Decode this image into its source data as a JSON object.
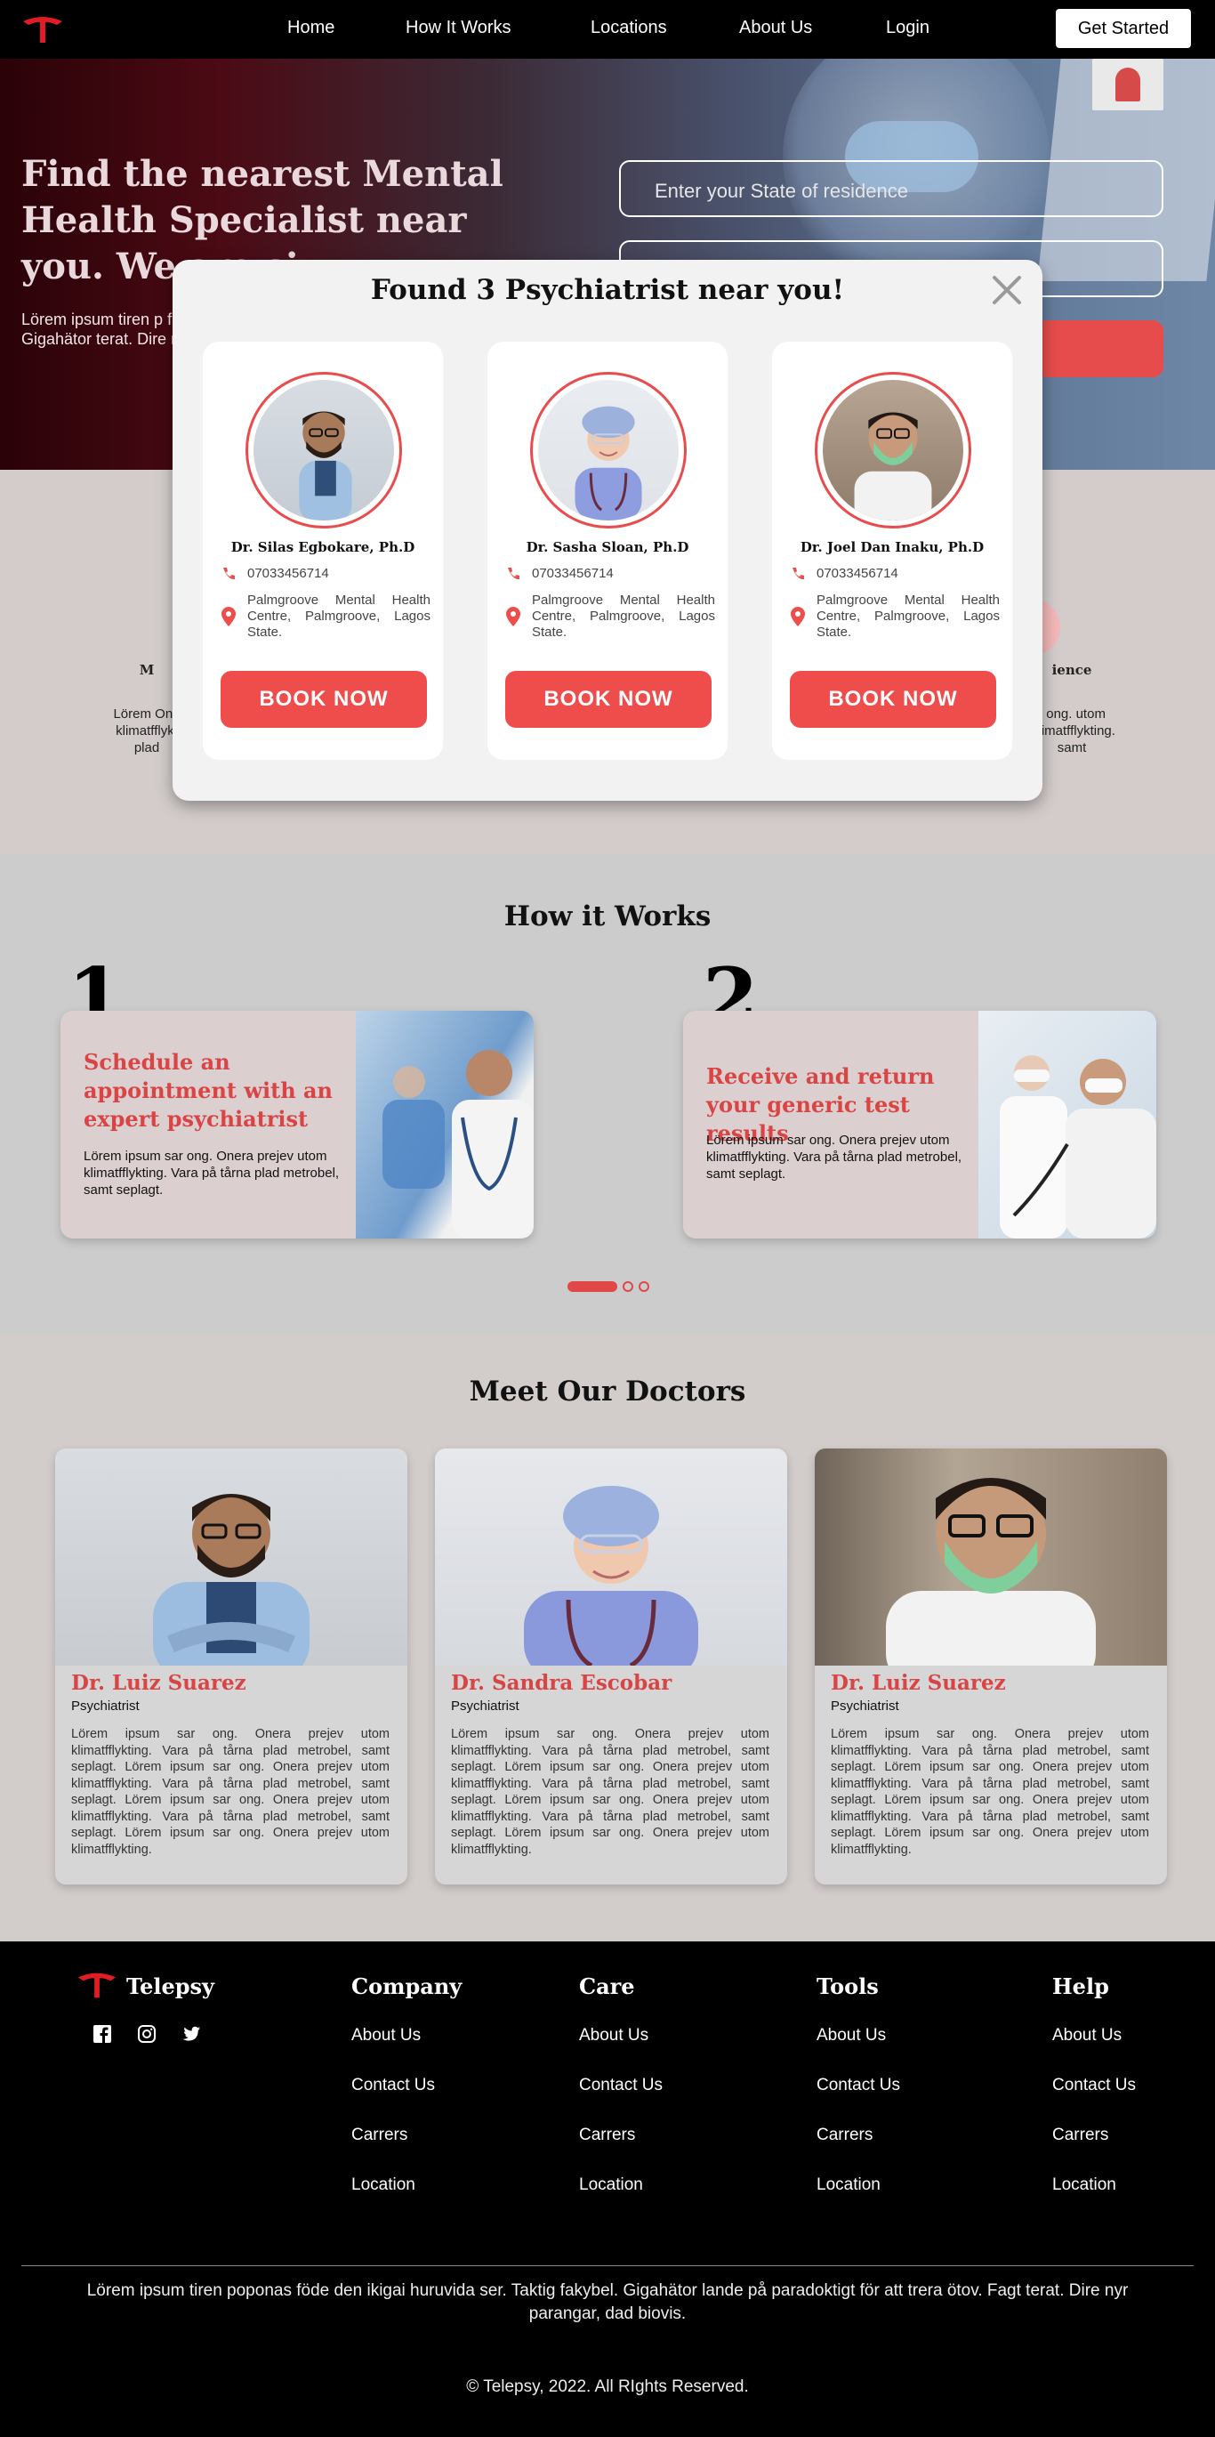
{
  "nav": {
    "links": [
      "Home",
      "How It Works",
      "Locations",
      "About Us",
      "Login"
    ],
    "cta": "Get Started",
    "brand_color": "#e31b23"
  },
  "hero": {
    "headline": "Find the nearest Mental Health Specialist near you. We are si",
    "body": "Lörem ipsum tiren p fakybel. Gigahätor terat. Dire nyr parar",
    "state_placeholder": "Enter your State of residence",
    "second_field": ""
  },
  "features": {
    "col_left_title": "M",
    "col_left_text": "Lörem One klimatfflykt plad",
    "col_right_title": "ience",
    "col_right_text": "r ong. utom klimatfflykting. samt"
  },
  "modal": {
    "title": "Found 3 Psychiatrist near you!",
    "close_icon": "close-icon",
    "results": [
      {
        "name": "Dr. Silas Egbokare, Ph.D",
        "phone": "07033456714",
        "address": "Palmgroove Mental Health Centre, Palmgroove, Lagos State.",
        "button": "BOOK NOW"
      },
      {
        "name": "Dr. Sasha Sloan, Ph.D",
        "phone": "07033456714",
        "address": "Palmgroove Mental Health Centre, Palmgroove, Lagos State.",
        "button": "BOOK NOW"
      },
      {
        "name": "Dr. Joel Dan Inaku, Ph.D",
        "phone": "07033456714",
        "address": "Palmgroove Mental Health Centre, Palmgroove, Lagos State.",
        "button": "BOOK NOW"
      }
    ]
  },
  "how": {
    "title": "How it Works",
    "steps": [
      {
        "number": "1",
        "title": "Schedule an appointment with an expert psychiatrist",
        "text": "Lörem ipsum sar ong. Onera prejev utom klimatfflykting. Vara på tårna plad metrobel, samt seplagt."
      },
      {
        "number": "2",
        "title": "Receive and return your generic test results",
        "text": "Lörem ipsum sar ong. Onera prejev utom klimatfflykting. Vara på tårna plad metrobel, samt seplagt."
      }
    ],
    "active_slide": 1,
    "slide_count": 3
  },
  "doctors": {
    "title": "Meet Our Doctors",
    "cards": [
      {
        "name": "Dr. Luiz Suarez",
        "role": "Psychiatrist",
        "bio": "Lörem ipsum sar ong. Onera prejev utom klimatfflykting. Vara på tårna plad metrobel, samt seplagt. Lörem ipsum sar ong. Onera prejev utom klimatfflykting. Vara på tårna plad metrobel, samt seplagt. Lörem ipsum sar ong. Onera prejev utom klimatfflykting. Vara på tårna plad metrobel, samt seplagt. Lörem ipsum sar ong. Onera prejev utom klimatfflykting."
      },
      {
        "name": "Dr. Sandra Escobar",
        "role": "Psychiatrist",
        "bio": "Lörem ipsum sar ong. Onera prejev utom klimatfflykting. Vara på tårna plad metrobel, samt seplagt. Lörem ipsum sar ong. Onera prejev utom klimatfflykting. Vara på tårna plad metrobel, samt seplagt. Lörem ipsum sar ong. Onera prejev utom klimatfflykting. Vara på tårna plad metrobel, samt seplagt. Lörem ipsum sar ong. Onera prejev utom klimatfflykting."
      },
      {
        "name": "Dr. Luiz Suarez",
        "role": "Psychiatrist",
        "bio": "Lörem ipsum sar ong. Onera prejev utom klimatfflykting. Vara på tårna plad metrobel, samt seplagt. Lörem ipsum sar ong. Onera prejev utom klimatfflykting. Vara på tårna plad metrobel, samt seplagt. Lörem ipsum sar ong. Onera prejev utom klimatfflykting. Vara på tårna plad metrobel, samt seplagt. Lörem ipsum sar ong. Onera prejev utom klimatfflykting."
      }
    ]
  },
  "footer": {
    "brand": "Telepsy",
    "social_icons": [
      "facebook-icon",
      "instagram-icon",
      "twitter-icon"
    ],
    "columns": [
      {
        "heading": "Company",
        "items": [
          "About Us",
          "Contact Us",
          "Carrers",
          "Location"
        ]
      },
      {
        "heading": "Care",
        "items": [
          "About Us",
          "Contact Us",
          "Carrers",
          "Location"
        ]
      },
      {
        "heading": "Tools",
        "items": [
          "About Us",
          "Contact Us",
          "Carrers",
          "Location"
        ]
      },
      {
        "heading": "Help",
        "items": [
          "About Us",
          "Contact Us",
          "Carrers",
          "Location"
        ]
      }
    ],
    "blurb": "Lörem ipsum tiren poponas föde den ikigai huruvida ser. Taktig fakybel. Gigahätor lande på paradoktigt för att trera ötov. Fagt terat. Dire nyr parangar, dad biovis.",
    "copyright": "© Telepsy, 2022. All RIghts Reserved."
  }
}
